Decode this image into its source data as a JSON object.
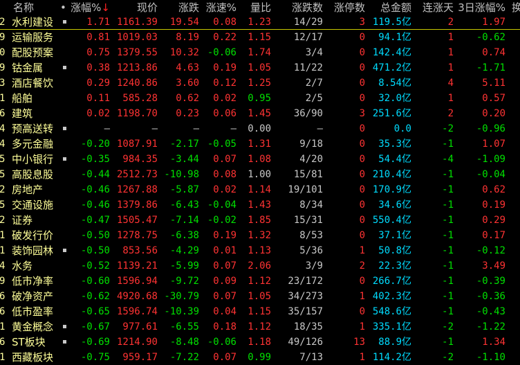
{
  "header": {
    "name": "名称",
    "dot": "•",
    "pct": "涨幅%",
    "sort_arrow": "↓",
    "price": "现价",
    "change": "涨跌",
    "speed": "涨速%",
    "vol_ratio": "量比",
    "updown": "涨跌数",
    "limit_up": "涨停数",
    "amount": "总金额",
    "streak": "连涨天",
    "pct3": "3日涨幅%",
    "cut": "换"
  },
  "colors": {
    "up": "#ff3333",
    "down": "#00e000",
    "flat": "#c8c8c8",
    "amount": "#00dcff",
    "name": "#ffff99"
  },
  "rows": [
    {
      "idx": "2",
      "name": "水利建设",
      "mark": true,
      "pct": "1.71",
      "price": "1161.39",
      "change": "19.54",
      "speed": "0.08",
      "vol_ratio": "1.23",
      "updown": "14/29",
      "limit_up": "3",
      "amount": "119.5亿",
      "streak": "2",
      "pct3": "1.97"
    },
    {
      "idx": "9",
      "name": "运输服务",
      "mark": false,
      "pct": "0.81",
      "price": "1019.03",
      "change": "8.19",
      "speed": "0.22",
      "vol_ratio": "1.15",
      "updown": "12/17",
      "limit_up": "0",
      "amount": "94.1亿",
      "streak": "1",
      "pct3": "-0.62"
    },
    {
      "idx": "0",
      "name": "配股预案",
      "mark": false,
      "pct": "0.75",
      "price": "1379.55",
      "change": "10.32",
      "speed": "-0.06",
      "vol_ratio": "1.74",
      "updown": "3/4",
      "limit_up": "0",
      "amount": "142.4亿",
      "streak": "1",
      "pct3": "0.74"
    },
    {
      "idx": "9",
      "name": "钴金属",
      "mark": true,
      "pct": "0.38",
      "price": "1213.86",
      "change": "4.63",
      "speed": "0.19",
      "vol_ratio": "1.05",
      "updown": "11/22",
      "limit_up": "0",
      "amount": "471.2亿",
      "streak": "1",
      "pct3": "-1.71"
    },
    {
      "idx": "3",
      "name": "酒店餐饮",
      "mark": false,
      "pct": "0.29",
      "price": "1240.86",
      "change": "3.60",
      "speed": "0.12",
      "vol_ratio": "1.25",
      "updown": "2/7",
      "limit_up": "0",
      "amount": "8.54亿",
      "streak": "4",
      "pct3": "5.11"
    },
    {
      "idx": "1",
      "name": "船舶",
      "mark": false,
      "pct": "0.11",
      "price": "585.28",
      "change": "0.62",
      "speed": "0.02",
      "vol_ratio": "0.95",
      "updown": "2/5",
      "limit_up": "0",
      "amount": "32.0亿",
      "streak": "1",
      "pct3": "0.57"
    },
    {
      "idx": "6",
      "name": "建筑",
      "mark": false,
      "pct": "0.02",
      "price": "1198.70",
      "change": "0.23",
      "speed": "0.06",
      "vol_ratio": "1.45",
      "updown": "36/90",
      "limit_up": "3",
      "amount": "251.6亿",
      "streak": "2",
      "pct3": "0.20"
    },
    {
      "idx": "4",
      "name": "预高送转",
      "mark": true,
      "pct": "—",
      "price": "—",
      "change": "—",
      "speed": "—",
      "vol_ratio": "0.00",
      "updown": "—",
      "limit_up": "0",
      "amount": "0.0",
      "streak": "-2",
      "pct3": "-0.96"
    },
    {
      "idx": "4",
      "name": "多元金融",
      "mark": false,
      "pct": "-0.20",
      "price": "1087.91",
      "change": "-2.17",
      "speed": "-0.05",
      "vol_ratio": "1.31",
      "updown": "9/18",
      "limit_up": "0",
      "amount": "35.3亿",
      "streak": "-1",
      "pct3": "1.07"
    },
    {
      "idx": "5",
      "name": "中小银行",
      "mark": true,
      "pct": "-0.35",
      "price": "984.35",
      "change": "-3.44",
      "speed": "0.07",
      "vol_ratio": "1.08",
      "updown": "4/20",
      "limit_up": "0",
      "amount": "54.4亿",
      "streak": "-4",
      "pct3": "-1.09"
    },
    {
      "idx": "5",
      "name": "高股息股",
      "mark": false,
      "pct": "-0.44",
      "price": "2512.73",
      "change": "-10.98",
      "speed": "0.08",
      "vol_ratio": "1.00",
      "updown": "15/81",
      "limit_up": "0",
      "amount": "210.4亿",
      "streak": "-1",
      "pct3": "-0.04"
    },
    {
      "idx": "2",
      "name": "房地产",
      "mark": false,
      "pct": "-0.46",
      "price": "1267.88",
      "change": "-5.87",
      "speed": "0.02",
      "vol_ratio": "1.14",
      "updown": "19/101",
      "limit_up": "0",
      "amount": "170.9亿",
      "streak": "-1",
      "pct3": "0.62"
    },
    {
      "idx": "5",
      "name": "交通设施",
      "mark": false,
      "pct": "-0.46",
      "price": "1379.86",
      "change": "-6.43",
      "speed": "-0.04",
      "vol_ratio": "1.43",
      "updown": "8/34",
      "limit_up": "0",
      "amount": "34.6亿",
      "streak": "-1",
      "pct3": "0.19"
    },
    {
      "idx": "2",
      "name": "证券",
      "mark": false,
      "pct": "-0.47",
      "price": "1505.47",
      "change": "-7.14",
      "speed": "-0.02",
      "vol_ratio": "1.85",
      "updown": "15/31",
      "limit_up": "0",
      "amount": "550.4亿",
      "streak": "-1",
      "pct3": "0.29"
    },
    {
      "idx": "1",
      "name": "破发行价",
      "mark": false,
      "pct": "-0.50",
      "price": "1278.75",
      "change": "-6.38",
      "speed": "0.19",
      "vol_ratio": "1.32",
      "updown": "8/53",
      "limit_up": "0",
      "amount": "37.1亿",
      "streak": "-1",
      "pct3": "0.17"
    },
    {
      "idx": "1",
      "name": "装饰园林",
      "mark": true,
      "pct": "-0.50",
      "price": "853.56",
      "change": "-4.29",
      "speed": "0.01",
      "vol_ratio": "1.13",
      "updown": "5/36",
      "limit_up": "1",
      "amount": "50.8亿",
      "streak": "-1",
      "pct3": "-0.12"
    },
    {
      "idx": "4",
      "name": "水务",
      "mark": false,
      "pct": "-0.52",
      "price": "1139.21",
      "change": "-5.99",
      "speed": "0.07",
      "vol_ratio": "2.06",
      "updown": "3/9",
      "limit_up": "2",
      "amount": "22.3亿",
      "streak": "-1",
      "pct3": "3.49"
    },
    {
      "idx": "9",
      "name": "低市净率",
      "mark": false,
      "pct": "-0.60",
      "price": "1596.94",
      "change": "-9.72",
      "speed": "0.09",
      "vol_ratio": "1.12",
      "updown": "23/172",
      "limit_up": "0",
      "amount": "266.7亿",
      "streak": "-1",
      "pct3": "-0.39"
    },
    {
      "idx": "6",
      "name": "破净资产",
      "mark": false,
      "pct": "-0.62",
      "price": "4920.68",
      "change": "-30.79",
      "speed": "0.07",
      "vol_ratio": "1.05",
      "updown": "34/273",
      "limit_up": "1",
      "amount": "402.3亿",
      "streak": "-1",
      "pct3": "-0.36"
    },
    {
      "idx": "6",
      "name": "低市盈率",
      "mark": false,
      "pct": "-0.65",
      "price": "1596.74",
      "change": "-10.39",
      "speed": "0.04",
      "vol_ratio": "1.15",
      "updown": "35/157",
      "limit_up": "0",
      "amount": "548.6亿",
      "streak": "-1",
      "pct3": "-0.43"
    },
    {
      "idx": "1",
      "name": "黄金概念",
      "mark": true,
      "pct": "-0.67",
      "price": "977.61",
      "change": "-6.55",
      "speed": "0.18",
      "vol_ratio": "1.12",
      "updown": "18/35",
      "limit_up": "1",
      "amount": "335.1亿",
      "streak": "-2",
      "pct3": "-1.22"
    },
    {
      "idx": "6",
      "name": "ST板块",
      "mark": true,
      "pct": "-0.69",
      "price": "1214.90",
      "change": "-8.48",
      "speed": "-0.06",
      "vol_ratio": "1.18",
      "updown": "49/126",
      "limit_up": "13",
      "amount": "88.9亿",
      "streak": "-1",
      "pct3": "1.34"
    },
    {
      "idx": "1",
      "name": "西藏板块",
      "mark": false,
      "pct": "-0.75",
      "price": "959.17",
      "change": "-7.22",
      "speed": "0.07",
      "vol_ratio": "0.99",
      "updown": "7/13",
      "limit_up": "1",
      "amount": "114.2亿",
      "streak": "-2",
      "pct3": "-1.10"
    }
  ]
}
